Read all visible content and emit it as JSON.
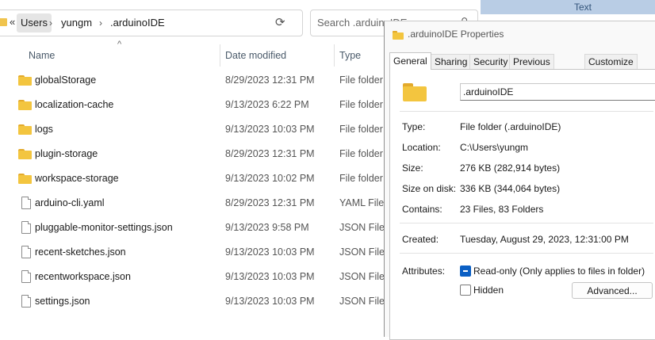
{
  "explorer": {
    "address": {
      "prev_glyph": "«",
      "crumbs": [
        "Users",
        "yungm",
        ".arduinoIDE"
      ],
      "separator": "›"
    },
    "search": {
      "placeholder": "Search .arduinoIDE",
      "icon": "search-icon"
    },
    "columns": {
      "name": "Name",
      "date": "Date modified",
      "type": "Type"
    },
    "rows": [
      {
        "name": "globalStorage",
        "date": "8/29/2023 12:31 PM",
        "type": "File folder",
        "kind": "folder"
      },
      {
        "name": "localization-cache",
        "date": "9/13/2023 6:22 PM",
        "type": "File folder",
        "kind": "folder"
      },
      {
        "name": "logs",
        "date": "9/13/2023 10:03 PM",
        "type": "File folder",
        "kind": "folder"
      },
      {
        "name": "plugin-storage",
        "date": "8/29/2023 12:31 PM",
        "type": "File folder",
        "kind": "folder"
      },
      {
        "name": "workspace-storage",
        "date": "9/13/2023 10:02 PM",
        "type": "File folder",
        "kind": "folder"
      },
      {
        "name": "arduino-cli.yaml",
        "date": "8/29/2023 12:31 PM",
        "type": "YAML File",
        "kind": "file"
      },
      {
        "name": "pluggable-monitor-settings.json",
        "date": "9/13/2023 9:58 PM",
        "type": "JSON File",
        "kind": "file"
      },
      {
        "name": "recent-sketches.json",
        "date": "9/13/2023 10:03 PM",
        "type": "JSON File",
        "kind": "file"
      },
      {
        "name": "recentworkspace.json",
        "date": "9/13/2023 10:03 PM",
        "type": "JSON File",
        "kind": "file"
      },
      {
        "name": "settings.json",
        "date": "9/13/2023 10:03 PM",
        "type": "JSON File",
        "kind": "file"
      }
    ]
  },
  "background": {
    "header_text": "Text"
  },
  "dialog": {
    "title": ".arduinoIDE Properties",
    "tabs": [
      "General",
      "Sharing",
      "Security",
      "Previous Versions",
      "Customize"
    ],
    "active_tab": "General",
    "folder_name": ".arduinoIDE",
    "props": {
      "type_label": "Type:",
      "type_value": "File folder (.arduinoIDE)",
      "location_label": "Location:",
      "location_value": "C:\\Users\\yungm",
      "size_label": "Size:",
      "size_value": "276 KB (282,914 bytes)",
      "disk_label": "Size on disk:",
      "disk_value": "336 KB (344,064 bytes)",
      "contains_label": "Contains:",
      "contains_value": "23 Files, 83 Folders",
      "created_label": "Created:",
      "created_value": "Tuesday, August 29, 2023, 12:31:00 PM",
      "attributes_label": "Attributes:"
    },
    "attributes": {
      "readonly_label": "Read-only (Only applies to files in folder)",
      "readonly_state": "indeterminate",
      "hidden_label": "Hidden",
      "hidden_state": "unchecked",
      "advanced_label": "Advanced..."
    }
  },
  "colors": {
    "folder": "#f3c53f",
    "accent": "#0a5fc4",
    "header_strip": "#b9cde5"
  }
}
